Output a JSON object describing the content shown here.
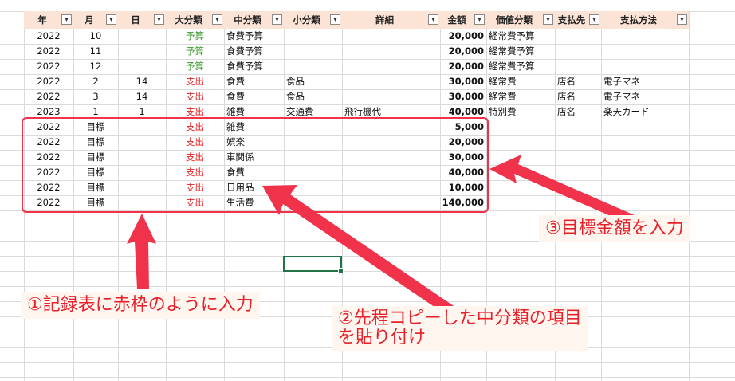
{
  "columns": [
    {
      "key": "year",
      "label": "年"
    },
    {
      "key": "month",
      "label": "月"
    },
    {
      "key": "day",
      "label": "日"
    },
    {
      "key": "major",
      "label": "大分類"
    },
    {
      "key": "middle",
      "label": "中分類"
    },
    {
      "key": "minor",
      "label": "小分類"
    },
    {
      "key": "detail",
      "label": "詳細"
    },
    {
      "key": "amount",
      "label": "金額"
    },
    {
      "key": "value_cat",
      "label": "価値分類"
    },
    {
      "key": "payee",
      "label": "支払先"
    },
    {
      "key": "method",
      "label": "支払方法"
    }
  ],
  "rows": [
    {
      "year": "2022",
      "month": "10",
      "day": "",
      "major": "予算",
      "middle": "食費予算",
      "minor": "",
      "detail": "",
      "amount": "20,000",
      "value_cat": "経常費予算",
      "payee": "",
      "method": ""
    },
    {
      "year": "2022",
      "month": "11",
      "day": "",
      "major": "予算",
      "middle": "食費予算",
      "minor": "",
      "detail": "",
      "amount": "20,000",
      "value_cat": "経常費予算",
      "payee": "",
      "method": ""
    },
    {
      "year": "2022",
      "month": "12",
      "day": "",
      "major": "予算",
      "middle": "食費予算",
      "minor": "",
      "detail": "",
      "amount": "20,000",
      "value_cat": "経常費予算",
      "payee": "",
      "method": ""
    },
    {
      "year": "2022",
      "month": "2",
      "day": "14",
      "major": "支出",
      "middle": "食費",
      "minor": "食品",
      "detail": "",
      "amount": "30,000",
      "value_cat": "経常費",
      "payee": "店名",
      "method": "電子マネー"
    },
    {
      "year": "2022",
      "month": "3",
      "day": "14",
      "major": "支出",
      "middle": "食費",
      "minor": "食品",
      "detail": "",
      "amount": "30,000",
      "value_cat": "経常費",
      "payee": "店名",
      "method": "電子マネー"
    },
    {
      "year": "2023",
      "month": "1",
      "day": "1",
      "major": "支出",
      "middle": "雑費",
      "minor": "交通費",
      "detail": "飛行機代",
      "amount": "40,000",
      "value_cat": "特別費",
      "payee": "店名",
      "method": "楽天カード"
    },
    {
      "year": "2022",
      "month": "目標",
      "day": "",
      "major": "支出",
      "middle": "雑費",
      "minor": "",
      "detail": "",
      "amount": "5,000",
      "value_cat": "",
      "payee": "",
      "method": ""
    },
    {
      "year": "2022",
      "month": "目標",
      "day": "",
      "major": "支出",
      "middle": "娯楽",
      "minor": "",
      "detail": "",
      "amount": "20,000",
      "value_cat": "",
      "payee": "",
      "method": ""
    },
    {
      "year": "2022",
      "month": "目標",
      "day": "",
      "major": "支出",
      "middle": "車関係",
      "minor": "",
      "detail": "",
      "amount": "30,000",
      "value_cat": "",
      "payee": "",
      "method": ""
    },
    {
      "year": "2022",
      "month": "目標",
      "day": "",
      "major": "支出",
      "middle": "食費",
      "minor": "",
      "detail": "",
      "amount": "40,000",
      "value_cat": "",
      "payee": "",
      "method": ""
    },
    {
      "year": "2022",
      "month": "目標",
      "day": "",
      "major": "支出",
      "middle": "日用品",
      "minor": "",
      "detail": "",
      "amount": "10,000",
      "value_cat": "",
      "payee": "",
      "method": ""
    },
    {
      "year": "2022",
      "month": "目標",
      "day": "",
      "major": "支出",
      "middle": "生活費",
      "minor": "",
      "detail": "",
      "amount": "140,000",
      "value_cat": "",
      "payee": "",
      "method": ""
    }
  ],
  "annotations": {
    "step1": "①記録表に赤枠のように入力",
    "step2_line1": "②先程コピーした中分類の項目",
    "step2_line2": "を貼り付け",
    "step3": "③目標金額を入力"
  },
  "icons": {
    "filter": "filter-dropdown-icon"
  },
  "colors": {
    "header_bg": "#fbe3d6",
    "budget_text": "#3a9a2a",
    "expense_text": "#e41e1e",
    "annotation": "#e8202a",
    "selection": "#217346"
  }
}
